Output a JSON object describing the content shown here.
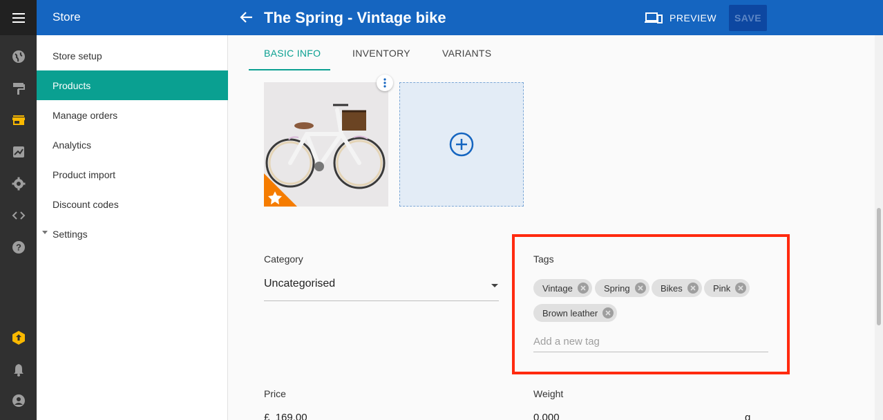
{
  "topbar": {
    "store_title": "Store",
    "page_title": "The Spring - Vintage bike",
    "preview_label": "PREVIEW",
    "save_label": "SAVE",
    "color": "#1565c0"
  },
  "rail": {
    "icons": [
      "menu-icon",
      "globe-icon",
      "paint-roller-icon",
      "store-icon",
      "chart-icon",
      "gear-icon",
      "code-icon",
      "help-icon",
      "upgrade-icon",
      "bell-icon",
      "account-icon"
    ],
    "active_color": "#f9b800"
  },
  "sidebar": {
    "items": [
      {
        "label": "Store setup"
      },
      {
        "label": "Products",
        "active": true
      },
      {
        "label": "Manage orders"
      },
      {
        "label": "Analytics"
      },
      {
        "label": "Product import"
      },
      {
        "label": "Discount codes"
      },
      {
        "label": "Settings"
      }
    ],
    "active_color": "#0aa091"
  },
  "tabs": [
    {
      "label": "BASIC INFO",
      "active": true
    },
    {
      "label": "INVENTORY"
    },
    {
      "label": "VARIANTS"
    }
  ],
  "form": {
    "category_label": "Category",
    "category_value": "Uncategorised",
    "tags_label": "Tags",
    "tags": [
      "Vintage",
      "Spring",
      "Bikes",
      "Pink",
      "Brown leather"
    ],
    "tag_placeholder": "Add a new tag",
    "price_label": "Price",
    "price_currency": "£",
    "price_value": "169.00",
    "weight_label": "Weight",
    "weight_value": "0.000",
    "weight_unit": "g"
  },
  "highlight_color": "#ff2a0f"
}
